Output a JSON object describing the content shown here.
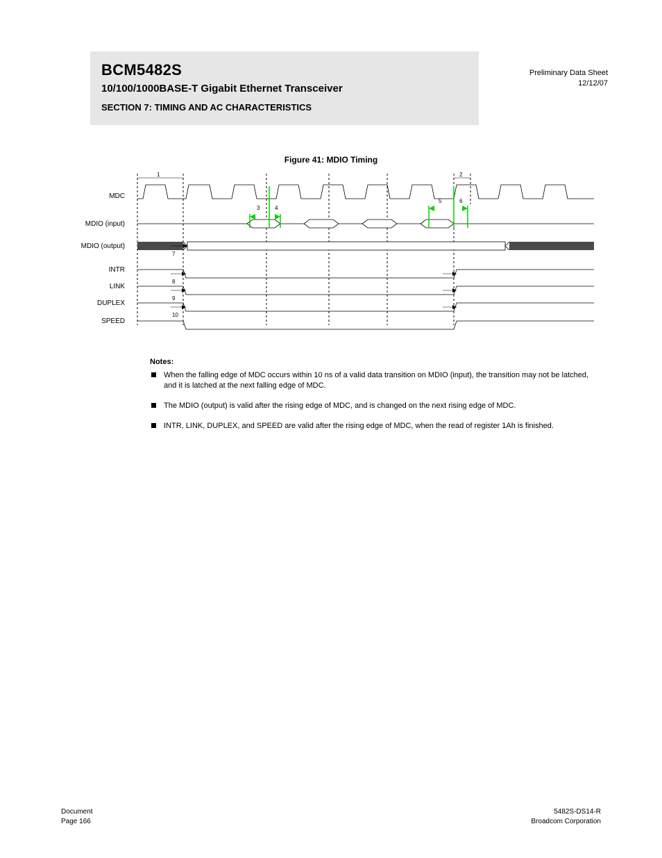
{
  "header": {
    "code": "BCM5482S",
    "title": "10/100/1000BASE-T Gigabit Ethernet Transceiver",
    "section": "SECTION 7: TIMING AND AC CHARACTERISTICS",
    "right_line1": "Preliminary Data Sheet",
    "right_line2": "12/12/07"
  },
  "figure": {
    "caption": "Figure 41:  MDIO Timing",
    "signals": [
      "MDC",
      "MDIO (input)",
      "MDIO (output)",
      "INTR",
      "LINK",
      "DUPLEX",
      "SPEED"
    ],
    "timing_labels": {
      "t1": "1",
      "t2": "2",
      "t3": "3",
      "t4": "4",
      "t5": "5",
      "t6": "6",
      "t7": "7",
      "t8": "8",
      "t9": "9",
      "t10": "10"
    }
  },
  "notes": {
    "title": "Notes:",
    "items": [
      "When the falling edge of MDC occurs within 10 ns of a valid data transition on MDIO (input), the transition may not be latched, and it is latched at the next falling edge of MDC.",
      "The MDIO (output) is valid after the rising edge of MDC, and is changed on the next rising edge of MDC.",
      "INTR, LINK, DUPLEX, and SPEED are valid after the rising edge of MDC, when the read of register 1Ah is finished."
    ]
  },
  "footer": {
    "left_line1": "Document",
    "left_line2": "Page  166",
    "right_line1": "5482S-DS14-R",
    "right_line2": "Broadcom Corporation",
    "doc_id": "5482S-DS14-R"
  },
  "colors": {
    "marker": "#00d400",
    "grey": "#e6e6e6",
    "dark": "#4a4a4a"
  }
}
